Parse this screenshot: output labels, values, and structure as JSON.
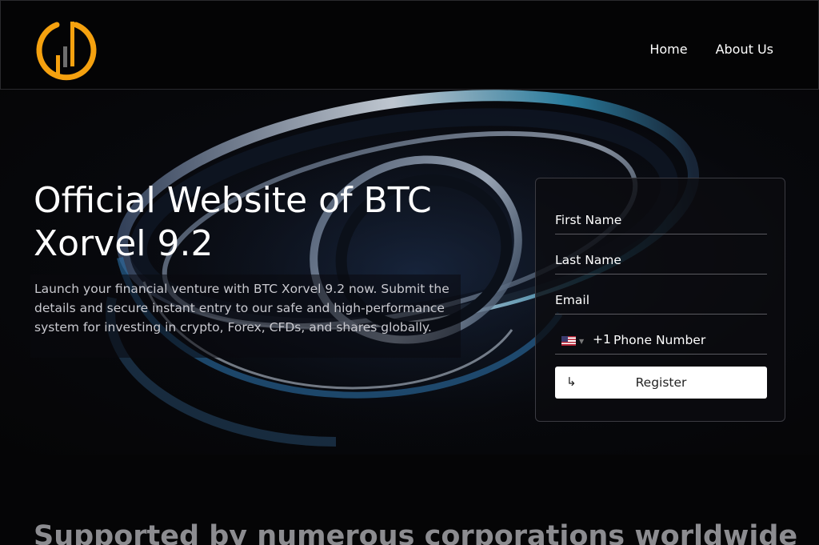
{
  "header": {
    "logo_icon": "power-chart-icon",
    "accent_color": "#F5A10F",
    "nav": [
      {
        "label": "Home"
      },
      {
        "label": "About Us"
      }
    ]
  },
  "hero": {
    "title": "Official Website of BTC Xorvel 9.2",
    "description": "Launch your financial venture with BTC Xorvel 9.2 now. Submit the details and secure instant entry to our safe and high-performance system for investing in crypto, Forex, CFDs, and shares globally."
  },
  "form": {
    "first_name_placeholder": "First Name",
    "last_name_placeholder": "Last Name",
    "email_placeholder": "Email",
    "phone_country_flag": "us-flag-icon",
    "phone_code": "+1",
    "phone_placeholder": "Phone Number",
    "register_label": "Register"
  },
  "section": {
    "title": "Supported by numerous corporations worldwide"
  }
}
